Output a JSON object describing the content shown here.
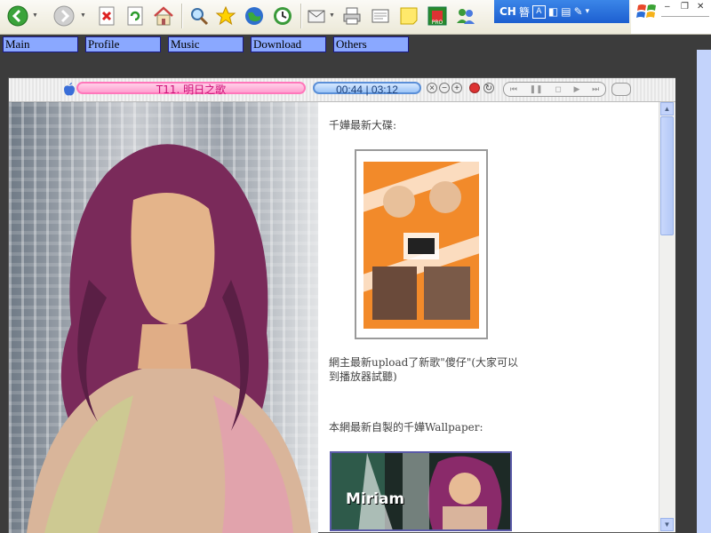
{
  "ime": {
    "lang": "CH",
    "char": "簪",
    "box": "A"
  },
  "nav": [
    {
      "label": "Main"
    },
    {
      "label": "Profile"
    },
    {
      "label": "Music"
    },
    {
      "label": "Download"
    },
    {
      "label": "Others"
    }
  ],
  "player": {
    "track": "T11. 明日之歌",
    "time": "00:44 | 03:12"
  },
  "article": {
    "heading": "千嬅最新大碟:",
    "upload_note": "網主最新upload了新歌\"傻仔\"(大家可以到播放器試聽)",
    "wallpaper_note": "本網最新自製的千嬅Wallpaper:",
    "wallpaper_label": "Miriam"
  },
  "colors": {
    "nav_bg": "#8aa8ff",
    "track_pill": "#ff9fd0",
    "time_pill": "#9cc4f7",
    "page_bg": "#3c3c3c"
  }
}
